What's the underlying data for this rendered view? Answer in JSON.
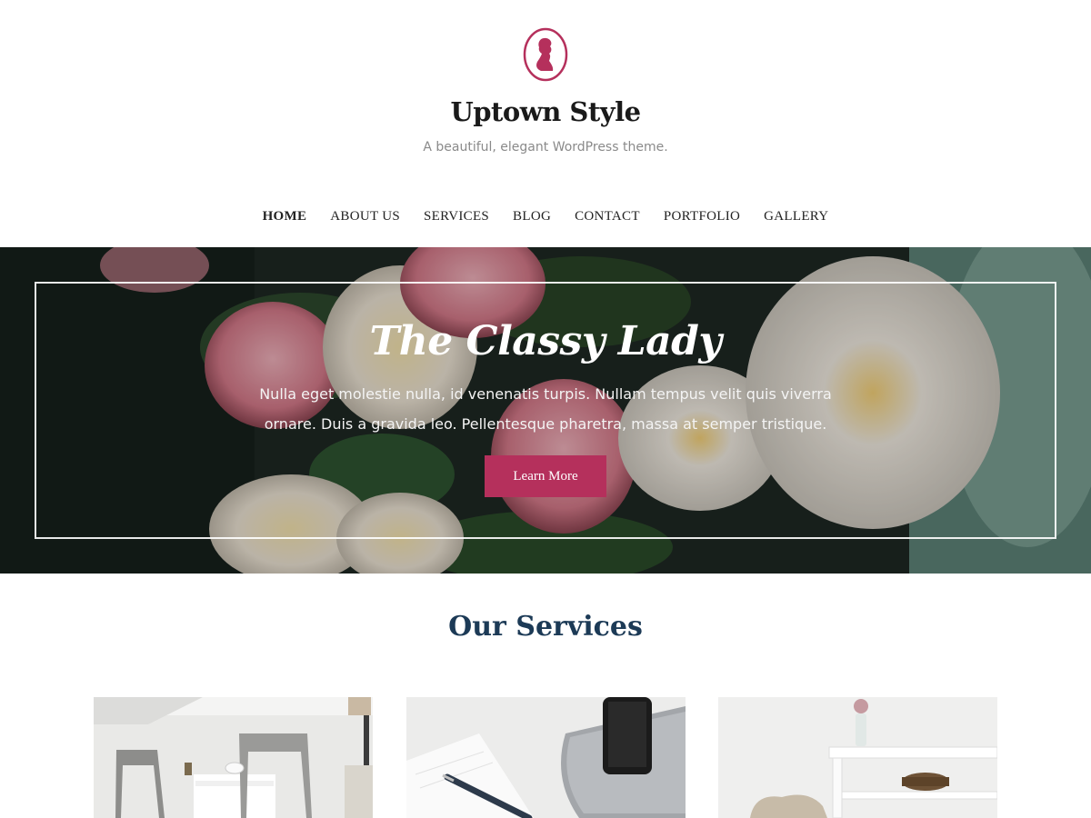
{
  "site": {
    "title": "Uptown Style",
    "tagline": "A beautiful, elegant WordPress theme.",
    "logo_icon": "cameo-lady-icon",
    "accent_color": "#b5305c"
  },
  "nav": {
    "items": [
      {
        "label": "HOME",
        "active": true
      },
      {
        "label": "ABOUT US"
      },
      {
        "label": "SERVICES"
      },
      {
        "label": "BLOG"
      },
      {
        "label": "CONTACT"
      },
      {
        "label": "PORTFOLIO"
      },
      {
        "label": "GALLERY"
      }
    ]
  },
  "hero": {
    "title": "The Classy Lady",
    "text": "Nulla eget molestie nulla, id venenatis turpis. Nullam tempus velit quis viverra ornare. Duis a gravida leo. Pellentesque pharetra, massa at semper tristique.",
    "button_label": "Learn More"
  },
  "services": {
    "heading": "Our Services",
    "heading_color": "#1c3a56"
  }
}
